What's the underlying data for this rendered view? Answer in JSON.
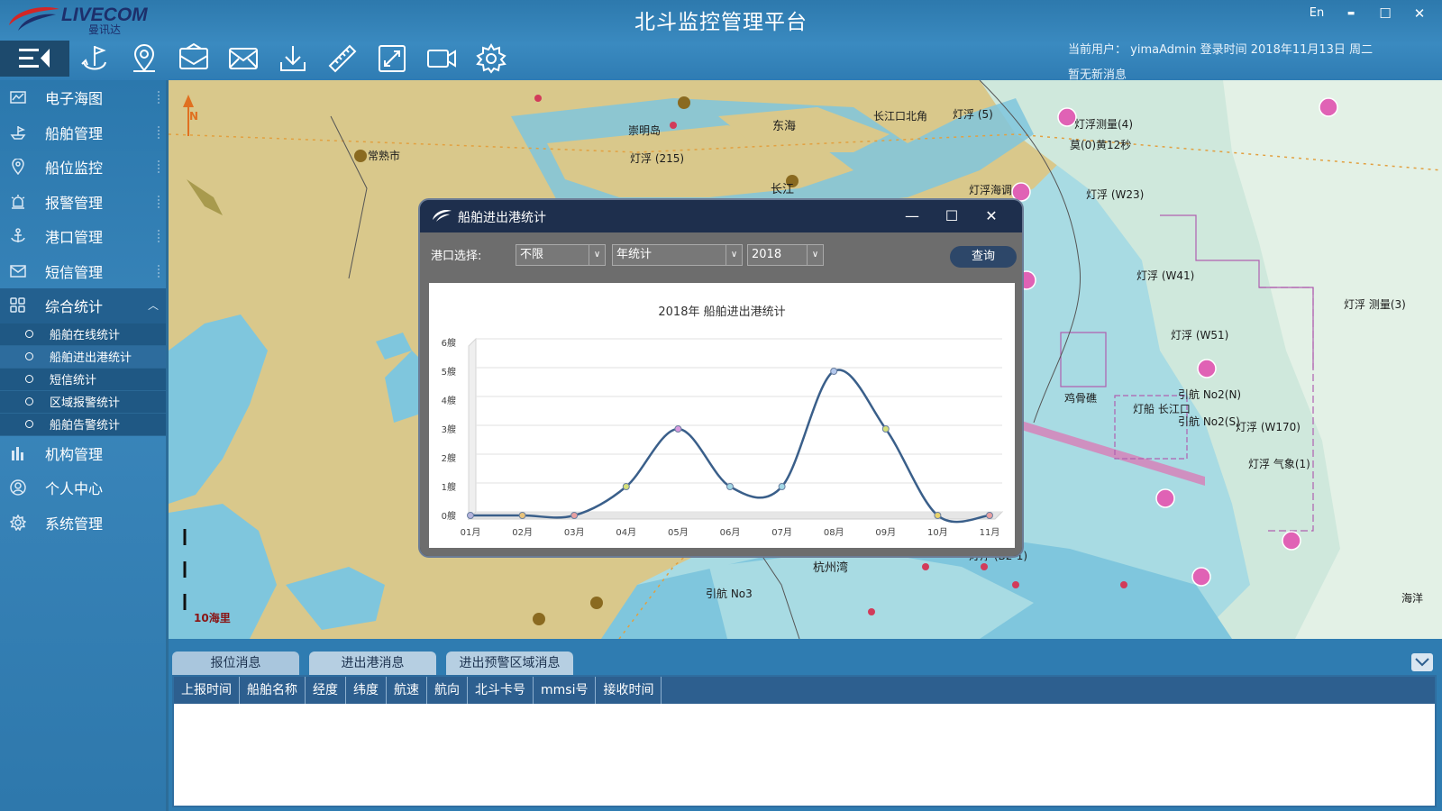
{
  "app": {
    "title": "北斗监控管理平台",
    "brand_en": "LIVECOM",
    "brand_cn": "曼讯达",
    "user_info": "当前用户： yimaAdmin  登录时间 2018年11月13日 周二",
    "message_info": "暂无新消息",
    "lang_button": "En",
    "window_controls": [
      "▬",
      "☐",
      "✕"
    ]
  },
  "toolbar": {
    "icons": [
      "anchor-icon",
      "location-pin-icon",
      "envelope-open-icon",
      "envelope-icon",
      "download-icon",
      "ruler-icon",
      "fullscreen-icon",
      "video-icon",
      "gear-icon"
    ]
  },
  "sidebar": {
    "items": [
      {
        "label": "电子海图",
        "icon": "chart-map-icon"
      },
      {
        "label": "船舶管理",
        "icon": "ship-icon"
      },
      {
        "label": "船位监控",
        "icon": "location-icon"
      },
      {
        "label": "报警管理",
        "icon": "alarm-icon"
      },
      {
        "label": "港口管理",
        "icon": "anchor-icon"
      },
      {
        "label": "短信管理",
        "icon": "mail-icon"
      },
      {
        "label": "综合统计",
        "icon": "stats-grid-icon"
      },
      {
        "label": "机构管理",
        "icon": "building-icon"
      },
      {
        "label": "个人中心",
        "icon": "user-icon"
      },
      {
        "label": "系统管理",
        "icon": "settings-icon"
      }
    ],
    "subitems": [
      "船舶在线统计",
      "船舶进出港统计",
      "短信统计",
      "区域报警统计",
      "船舶告警统计"
    ],
    "active_subitem": "船舶进出港统计"
  },
  "map": {
    "labels": {
      "city1": "常熟市",
      "place1": "崇明岛",
      "place2": "东海",
      "place3": "长江口北角",
      "place4": "灯浮 (5)",
      "place5": "灯浮测量(4)",
      "place6": "莫(0)黄12秒",
      "place7": "灯浮 (W23)",
      "place8": "灯浮 (W41)",
      "place9": "灯浮 测量(3)",
      "place10": "灯浮 (W51)",
      "place11": "鸡骨礁",
      "place12": "引航 No2(N)",
      "place13": "灯浮 (W170)",
      "place14": "灯船 长江口",
      "place15": "引航 No2(S)",
      "place16": "灯浮 气象(1)",
      "place17": "杭州湾",
      "place18": "引航 No3",
      "place19": "灯浮 (B2-1)",
      "place20": "海洋",
      "place21": "长江",
      "place22": "灯浮海调",
      "place23": "灯浮 (215)"
    },
    "north_label": "N",
    "scale_label": "10海里"
  },
  "dialog": {
    "title": "船舶进出港统计",
    "port_label": "港口选择:",
    "port_value": "不限",
    "period_value": "年统计",
    "year_value": "2018",
    "query_label": "查询",
    "controls": [
      "—",
      "☐",
      "✕"
    ]
  },
  "chart_data": {
    "type": "line",
    "title": "2018年 船舶进出港统计",
    "categories": [
      "01月",
      "02月",
      "03月",
      "04月",
      "05月",
      "06月",
      "07月",
      "08月",
      "09月",
      "10月",
      "11月"
    ],
    "values": [
      0,
      0,
      0,
      1,
      3,
      1,
      1,
      5,
      3,
      0,
      0
    ],
    "ytick_labels": [
      "0艘",
      "1艘",
      "2艘",
      "3艘",
      "4艘",
      "5艘",
      "6艘"
    ],
    "ylim": [
      0,
      6
    ],
    "grid": true,
    "smooth": true,
    "colors": {
      "line": "#3a5f8a",
      "points": [
        "#b4b4dc",
        "#e9c37a",
        "#e9a0a0",
        "#d6e07a",
        "#d79adf",
        "#a3d8e6",
        "#a3d8e6",
        "#b4c8ec",
        "#d6e07a",
        "#e9d36a",
        "#e9a0a0"
      ]
    }
  },
  "bottom": {
    "tabs": [
      "报位消息",
      "进出港消息",
      "进出预警区域消息"
    ],
    "columns": [
      "上报时间",
      "船舶名称",
      "经度",
      "纬度",
      "航速",
      "航向",
      "北斗卡号",
      "mmsi号",
      "接收时间"
    ]
  }
}
